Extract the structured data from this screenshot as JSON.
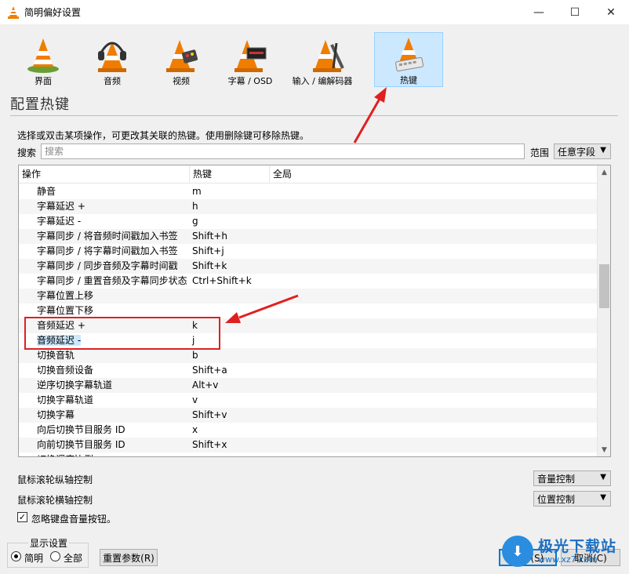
{
  "window": {
    "title": "简明偏好设置",
    "minimize": "—",
    "maximize": "☐",
    "close": "✕"
  },
  "categories": [
    {
      "label": "界面",
      "icon": "interface-cone-icon"
    },
    {
      "label": "音频",
      "icon": "audio-headphones-cone-icon"
    },
    {
      "label": "视频",
      "icon": "video-cone-icon"
    },
    {
      "label": "字幕 / OSD",
      "icon": "subtitle-osd-cone-icon"
    },
    {
      "label": "输入 / 编解码器",
      "icon": "input-codec-cone-icon"
    },
    {
      "label": "热键",
      "icon": "hotkeys-cone-icon",
      "selected": true
    }
  ],
  "section_title": "配置热键",
  "hint": "选择或双击某项操作，可更改其关联的热键。使用删除键可移除热键。",
  "search": {
    "label": "搜索",
    "placeholder": "搜索",
    "scope_label": "范围",
    "scope_value": "任意字段"
  },
  "table": {
    "headers": [
      "操作",
      "热键",
      "全局"
    ],
    "rows": [
      {
        "action": "静音",
        "hotkey": "m"
      },
      {
        "action": "字幕延迟 +",
        "hotkey": "h"
      },
      {
        "action": "字幕延迟 -",
        "hotkey": "g"
      },
      {
        "action": "字幕同步 / 将音频时间戳加入书签",
        "hotkey": "Shift+h"
      },
      {
        "action": "字幕同步 / 将字幕时间戳加入书签",
        "hotkey": "Shift+j"
      },
      {
        "action": "字幕同步 / 同步音频及字幕时间戳",
        "hotkey": "Shift+k"
      },
      {
        "action": "字幕同步 / 重置音频及字幕同步状态",
        "hotkey": "Ctrl+Shift+k"
      },
      {
        "action": "字幕位置上移",
        "hotkey": ""
      },
      {
        "action": "字幕位置下移",
        "hotkey": ""
      },
      {
        "action": "音频延迟 +",
        "hotkey": "k"
      },
      {
        "action": "音频延迟 -",
        "hotkey": "j"
      },
      {
        "action": "切换音轨",
        "hotkey": "b"
      },
      {
        "action": "切换音频设备",
        "hotkey": "Shift+a"
      },
      {
        "action": "逆序切换字幕轨道",
        "hotkey": "Alt+v"
      },
      {
        "action": "切换字幕轨道",
        "hotkey": "v"
      },
      {
        "action": "切换字幕",
        "hotkey": "Shift+v"
      },
      {
        "action": "向后切换节目服务 ID",
        "hotkey": "x"
      },
      {
        "action": "向前切换节目服务 ID",
        "hotkey": "Shift+x"
      },
      {
        "action": "切换调度比例",
        "hotkey": ""
      }
    ],
    "selected_row": 10
  },
  "mouse_wheel_vertical": {
    "label": "鼠标滚轮纵轴控制",
    "value": "音量控制"
  },
  "mouse_wheel_horizontal": {
    "label": "鼠标滚轮横轴控制",
    "value": "位置控制"
  },
  "ignore_volume_keys": {
    "label": "忽略键盘音量按钮。",
    "checked": true,
    "check": "✓"
  },
  "display_settings": {
    "title": "显示设置",
    "simple": "简明",
    "all": "全部"
  },
  "buttons": {
    "reset": "重置参数(R)",
    "save": "保存(S)",
    "cancel": "取消(C)"
  },
  "watermark": {
    "name": "极光下载站",
    "url": "www.xz7.com"
  },
  "colors": {
    "selection": "#cce8ff",
    "highlight_box": "#e02020",
    "accent": "#0078d7"
  }
}
